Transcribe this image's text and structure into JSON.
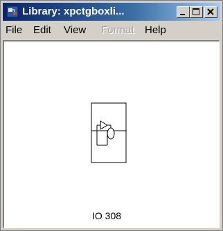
{
  "window": {
    "title": "Library: xpctgboxli...",
    "icon": "simulink-library-icon"
  },
  "title_buttons": {
    "minimize": "minimize-icon",
    "maximize": "maximize-icon",
    "close": "close-icon"
  },
  "menu": {
    "items": [
      {
        "label": "File",
        "enabled": true
      },
      {
        "label": "Edit",
        "enabled": true
      },
      {
        "label": "View",
        "enabled": true
      },
      {
        "label": "Format",
        "enabled": false
      },
      {
        "label": "Help",
        "enabled": true
      }
    ]
  },
  "canvas": {
    "block": {
      "label": "IO 308",
      "icon": "io-block-icon"
    }
  },
  "colors": {
    "title_start": "#0a246a",
    "title_end": "#a6caf0",
    "chrome": "#d4d0c8",
    "canvas": "#ffffff"
  }
}
